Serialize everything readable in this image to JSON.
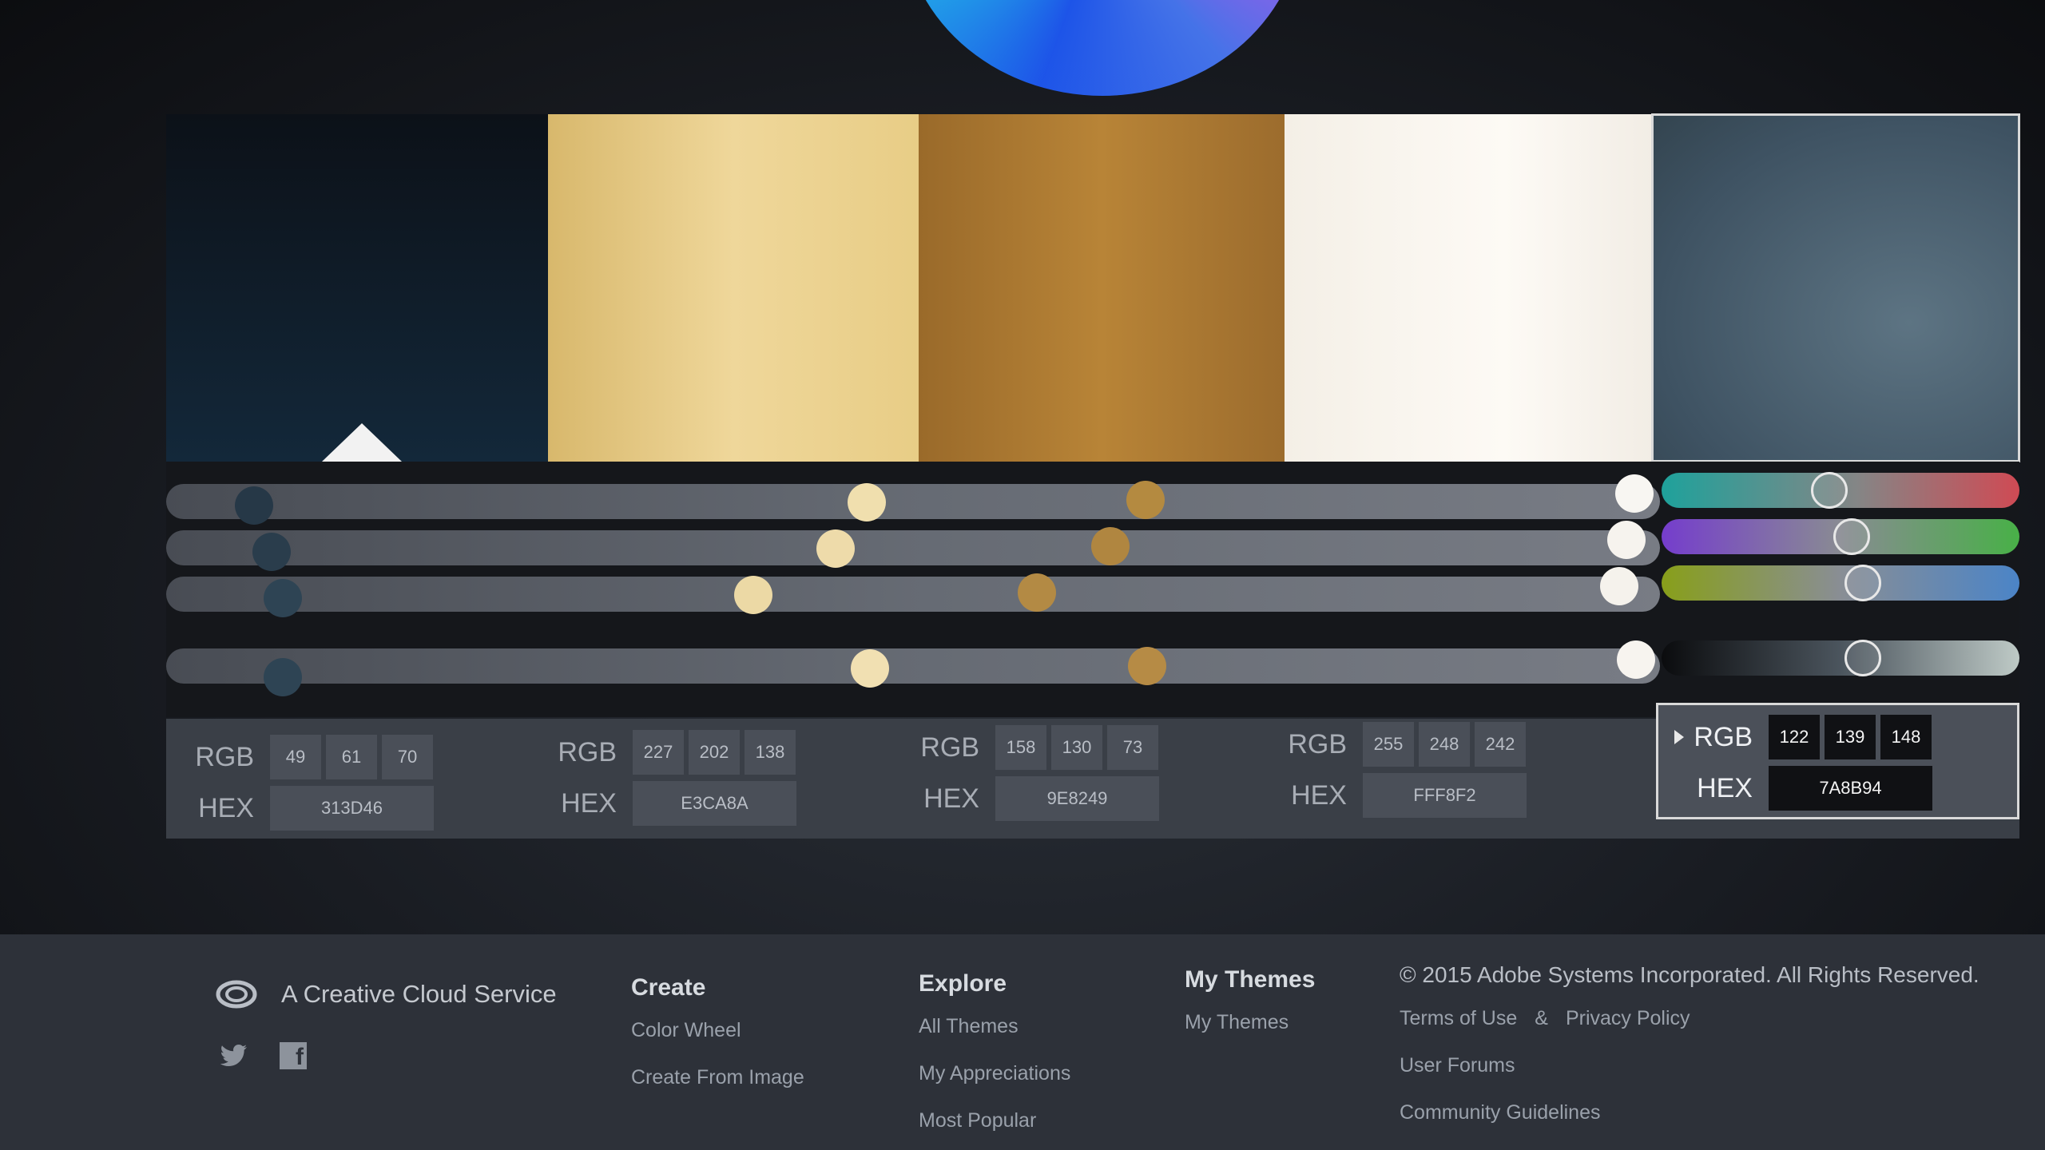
{
  "palette": {
    "swatches": [
      {
        "hex_label": "313D46",
        "rgb": [
          "49",
          "61",
          "70"
        ],
        "color": "#0f1d2a",
        "base": true
      },
      {
        "hex_label": "E3CA8A",
        "rgb": [
          "227",
          "202",
          "138"
        ],
        "color": "#e3ca8a"
      },
      {
        "hex_label": "9E8249",
        "rgb": [
          "158",
          "130",
          "73"
        ],
        "color": "#a8782e"
      },
      {
        "hex_label": "FFF8F2",
        "rgb": [
          "255",
          "248",
          "242"
        ],
        "color": "#fbf6ef"
      },
      {
        "hex_label": "7A8B94",
        "rgb": [
          "122",
          "139",
          "148"
        ],
        "color": "#4f6473",
        "selected": true
      }
    ]
  },
  "labels": {
    "rgb": "RGB",
    "hex": "HEX"
  },
  "footer": {
    "service_text": "A Creative Cloud Service",
    "create": {
      "heading": "Create",
      "links": [
        "Color Wheel",
        "Create From Image"
      ]
    },
    "explore": {
      "heading": "Explore",
      "links": [
        "All Themes",
        "My Appreciations",
        "Most Popular"
      ]
    },
    "mythemes": {
      "heading": "My Themes",
      "links": [
        "My Themes"
      ]
    },
    "legal": {
      "copyright": "© 2015 Adobe Systems Incorporated. All Rights Reserved.",
      "terms": "Terms of Use",
      "amp": "&",
      "privacy": "Privacy Policy",
      "forums": "User Forums",
      "guidelines": "Community Guidelines"
    },
    "facebook_glyph": "f"
  },
  "icons": [
    "creative-cloud-icon",
    "twitter-icon",
    "facebook-icon",
    "caret-right-icon"
  ]
}
